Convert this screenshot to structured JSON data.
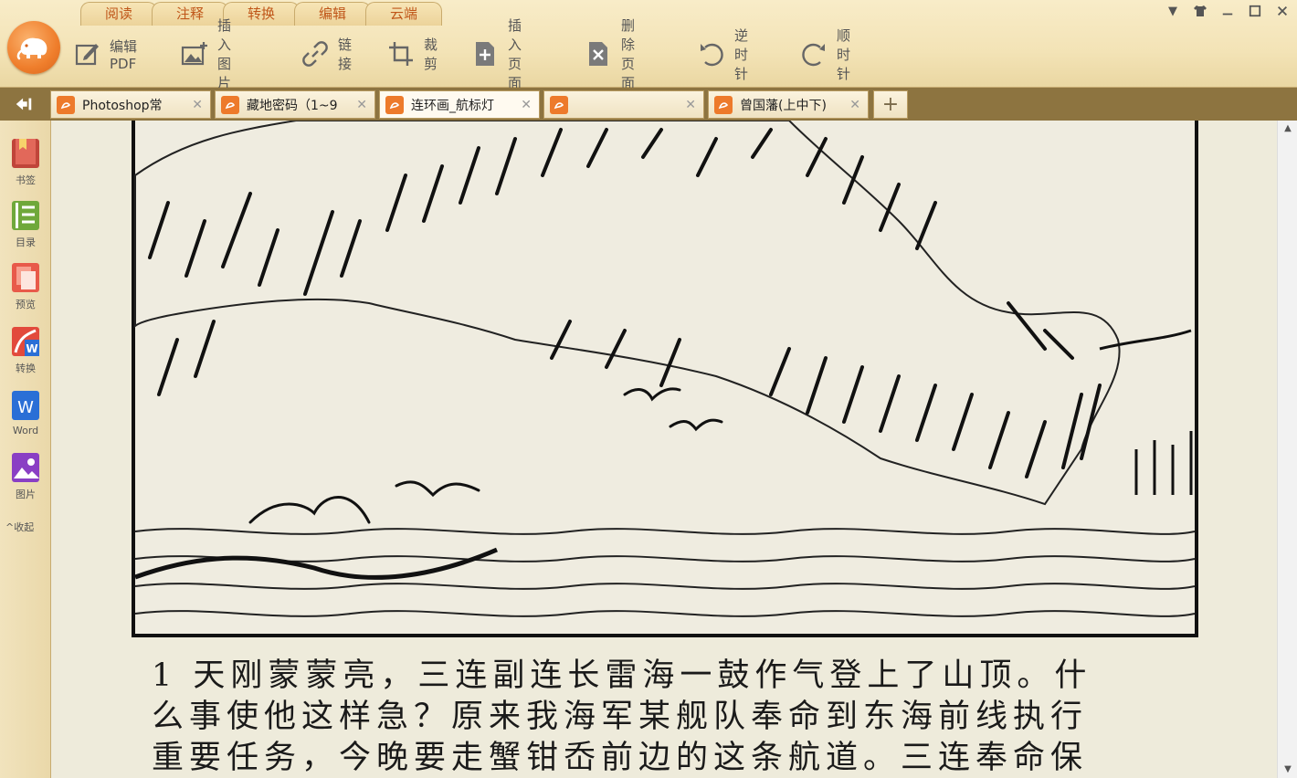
{
  "main_tabs": [
    "阅读",
    "注释",
    "转换",
    "编辑",
    "云端"
  ],
  "toolbar": [
    {
      "label": "编辑PDF",
      "icon": "edit-pdf-icon"
    },
    {
      "label": "插入图片",
      "icon": "insert-image-icon"
    },
    {
      "label": "链接",
      "icon": "link-icon"
    },
    {
      "label": "裁剪",
      "icon": "crop-icon"
    },
    {
      "label": "插入页面",
      "icon": "insert-page-icon"
    },
    {
      "label": "删除页面",
      "icon": "delete-page-icon"
    },
    {
      "label": "逆时针",
      "icon": "rotate-ccw-icon"
    },
    {
      "label": "顺时针",
      "icon": "rotate-cw-icon"
    }
  ],
  "doc_tabs": [
    {
      "label": "Photoshop常",
      "active": false
    },
    {
      "label": "藏地密码（1~9",
      "active": false
    },
    {
      "label": "连环画_航标灯",
      "active": true
    },
    {
      "label": "",
      "active": false
    },
    {
      "label": "曾国藩(上中下)",
      "active": false
    }
  ],
  "new_tab_label": "+",
  "sidebar": [
    {
      "label": "书签",
      "icon": "bookmark-icon"
    },
    {
      "label": "目录",
      "icon": "toc-icon"
    },
    {
      "label": "预览",
      "icon": "preview-icon"
    },
    {
      "label": "转换",
      "icon": "convert-icon"
    },
    {
      "label": "Word",
      "icon": "word-icon"
    },
    {
      "label": "图片",
      "icon": "picture-icon"
    }
  ],
  "sidebar_collapse": "^收起",
  "caption_lines": [
    "1  天刚蒙蒙亮，三连副连长雷海一鼓作气登上了山顶。什",
    "么事使他这样急？原来我海军某舰队奉命到东海前线执行",
    "重要任务，今晚要走蟹钳岙前边的这条航道。三连奉命保"
  ],
  "colors": {
    "accent": "#ed7a2b",
    "tab_text": "#c0571a",
    "tabrow": "#8d7440",
    "paper": "#eeebdb"
  }
}
